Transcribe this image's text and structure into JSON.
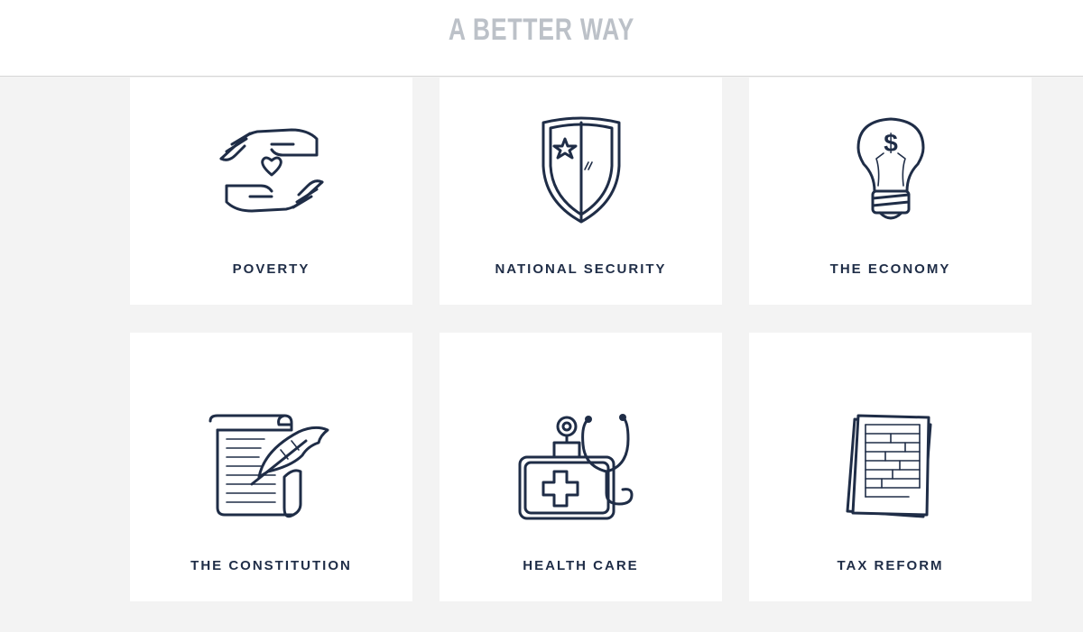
{
  "header": {
    "title": "A BETTER WAY"
  },
  "cards": [
    {
      "label": "POVERTY",
      "icon": "hands-heart-icon"
    },
    {
      "label": "NATIONAL SECURITY",
      "icon": "shield-star-icon"
    },
    {
      "label": "THE ECONOMY",
      "icon": "lightbulb-dollar-icon"
    },
    {
      "label": "THE CONSTITUTION",
      "icon": "scroll-quill-icon"
    },
    {
      "label": "HEALTH CARE",
      "icon": "medical-bag-stethoscope-icon"
    },
    {
      "label": "TAX REFORM",
      "icon": "tax-documents-icon"
    }
  ],
  "colors": {
    "text": "#1f2d47",
    "header_title": "#bcc1c8",
    "background": "#f3f3f3",
    "card": "#ffffff"
  }
}
